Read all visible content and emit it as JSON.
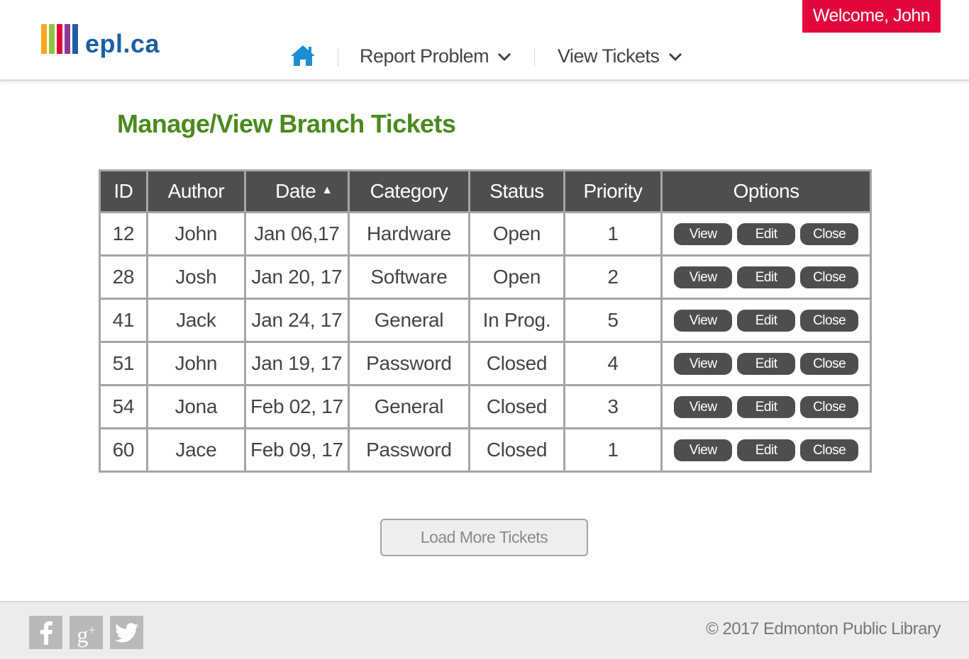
{
  "header": {
    "logo_text": "epl.ca",
    "logo_colors": [
      "#f6a81c",
      "#8dc63f",
      "#e2063c",
      "#8b3a96",
      "#1b5fa3"
    ],
    "welcome": "Welcome, John",
    "nav": {
      "home_icon": "home-icon",
      "report_problem": "Report Problem",
      "view_tickets": "View Tickets"
    }
  },
  "page": {
    "title": "Manage/View Branch Tickets"
  },
  "table": {
    "headers": [
      "ID",
      "Author",
      "Date",
      "Category",
      "Status",
      "Priority",
      "Options"
    ],
    "sort_indicator": "▲",
    "buttons": {
      "view": "View",
      "edit": "Edit",
      "close": "Close"
    },
    "rows": [
      {
        "id": "12",
        "author": "John",
        "date": "Jan 06,17",
        "category": "Hardware",
        "status": "Open",
        "priority": "1"
      },
      {
        "id": "28",
        "author": "Josh",
        "date": "Jan 20, 17",
        "category": "Software",
        "status": "Open",
        "priority": "2"
      },
      {
        "id": "41",
        "author": "Jack",
        "date": "Jan 24, 17",
        "category": "General",
        "status": "In Prog.",
        "priority": "5"
      },
      {
        "id": "51",
        "author": "John",
        "date": "Jan 19, 17",
        "category": "Password",
        "status": "Closed",
        "priority": "4"
      },
      {
        "id": "54",
        "author": "Jona",
        "date": "Feb 02, 17",
        "category": "General",
        "status": "Closed",
        "priority": "3"
      },
      {
        "id": "60",
        "author": "Jace",
        "date": "Feb 09, 17",
        "category": "Password",
        "status": "Closed",
        "priority": "1"
      }
    ]
  },
  "load_more": "Load More Tickets",
  "footer": {
    "social": [
      "facebook-icon",
      "google-plus-icon",
      "twitter-icon"
    ],
    "copyright": "© 2017 Edmonton Public Library"
  },
  "colors": {
    "accent_red": "#e2063c",
    "title_green": "#4b8a1e",
    "header_dark": "#4e4e4e",
    "home_blue": "#1b8fd2"
  }
}
